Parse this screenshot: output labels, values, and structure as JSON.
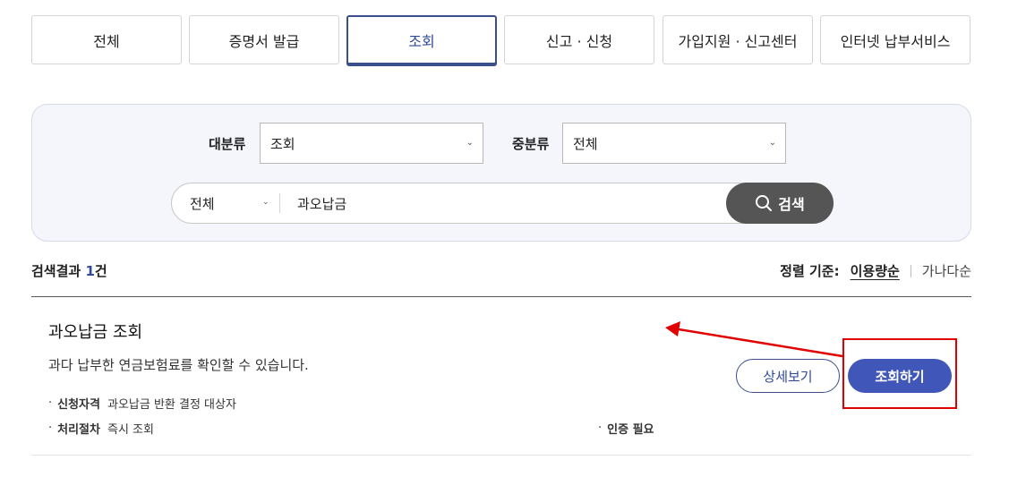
{
  "tabs": [
    {
      "label": "전체"
    },
    {
      "label": "증명서 발급"
    },
    {
      "label": "조회"
    },
    {
      "label": "신고 · 신청"
    },
    {
      "label": "가입지원 · 신고센터"
    },
    {
      "label": "인터넷 납부서비스"
    }
  ],
  "active_tab": "조회",
  "filters": {
    "major_label": "대분류",
    "major_value": "조회",
    "minor_label": "중분류",
    "minor_value": "전체"
  },
  "search": {
    "scope": "전체",
    "query": "과오납금",
    "button_label": "검색",
    "icon": "search-icon"
  },
  "results": {
    "prefix": "검색결과",
    "count": "1",
    "suffix": "건"
  },
  "sort": {
    "label": "정렬 기준:",
    "active": "이용량순",
    "alt": "가나다순"
  },
  "item": {
    "title": "과오납금 조회",
    "description": "과다 납부한 연금보험료를 확인할 수 있습니다.",
    "eligibility_key": "신청자격",
    "eligibility_value": "과오납금 반환 결정 대상자",
    "process_key": "처리절차",
    "process_value": "즉시 조회",
    "auth_note": "인증 필요",
    "detail_button": "상세보기",
    "query_button": "조회하기"
  },
  "colors": {
    "accent": "#2f4a96",
    "primary_button": "#4056b8",
    "search_button": "#555555",
    "annotation": "#e00000"
  }
}
